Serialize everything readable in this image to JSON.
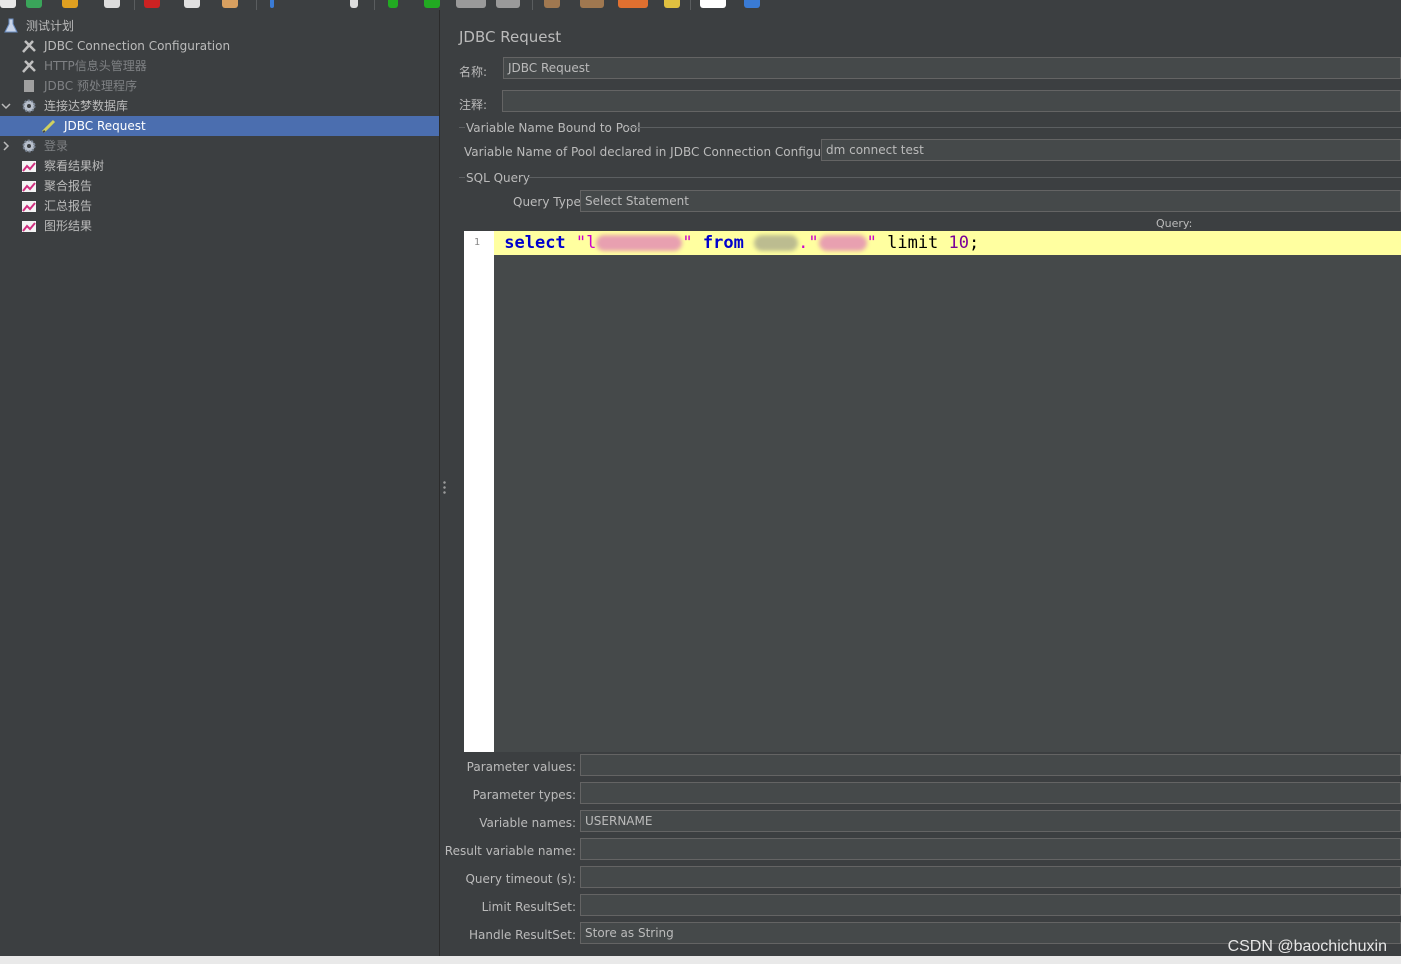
{
  "window": {
    "watermark": "CSDN @baochichuxin"
  },
  "tree": {
    "items": [
      {
        "label": "测试计划",
        "icon": "flask-icon",
        "level": 0,
        "selected": false,
        "disabled": false,
        "expander": ""
      },
      {
        "label": "JDBC Connection Configuration",
        "icon": "wrench-icon",
        "level": 1,
        "selected": false,
        "disabled": false,
        "expander": ""
      },
      {
        "label": "HTTP信息头管理器",
        "icon": "wrench-icon",
        "level": 1,
        "selected": false,
        "disabled": true,
        "expander": ""
      },
      {
        "label": "JDBC 预处理程序",
        "icon": "script-icon",
        "level": 1,
        "selected": false,
        "disabled": true,
        "expander": ""
      },
      {
        "label": "连接达梦数据库",
        "icon": "gear-icon",
        "level": 1,
        "selected": false,
        "disabled": false,
        "expander": "v"
      },
      {
        "label": "JDBC Request",
        "icon": "pen-icon",
        "level": 2,
        "selected": true,
        "disabled": false,
        "expander": ""
      },
      {
        "label": "登录",
        "icon": "gear-icon",
        "level": 1,
        "selected": false,
        "disabled": true,
        "expander": ">"
      },
      {
        "label": "察看结果树",
        "icon": "chart-icon",
        "level": 1,
        "selected": false,
        "disabled": false,
        "expander": ""
      },
      {
        "label": "聚合报告",
        "icon": "chart-icon",
        "level": 1,
        "selected": false,
        "disabled": false,
        "expander": ""
      },
      {
        "label": "汇总报告",
        "icon": "chart-icon",
        "level": 1,
        "selected": false,
        "disabled": false,
        "expander": ""
      },
      {
        "label": "图形结果",
        "icon": "chart-icon",
        "level": 1,
        "selected": false,
        "disabled": false,
        "expander": ""
      }
    ]
  },
  "form": {
    "title": "JDBC Request",
    "name_label": "名称:",
    "name_value": "JDBC Request",
    "comment_label": "注释:",
    "comment_value": "",
    "pool_group": "Variable Name Bound to Pool",
    "pool_label": "Variable Name of Pool declared in JDBC Connection Configuration:",
    "pool_value": "dm connect test",
    "sql_group": "SQL Query",
    "query_type_label": "Query Type:",
    "query_type_value": "Select Statement",
    "query_label": "Query:",
    "line_number": "1",
    "code": {
      "kw_select": "select",
      "quote_open": "\"",
      "partial_char": "l",
      "quote_close": "\"",
      "kw_from": "from",
      "dot_quote": ".\"",
      "quote_end": "\"",
      "kw_limit": "limit",
      "limit_value": "10",
      "semicolon": ";"
    },
    "params": [
      {
        "label": "Parameter values:",
        "value": ""
      },
      {
        "label": "Parameter types:",
        "value": ""
      },
      {
        "label": "Variable names:",
        "value": "USERNAME"
      },
      {
        "label": "Result variable name:",
        "value": ""
      },
      {
        "label": "Query timeout (s):",
        "value": ""
      },
      {
        "label": "Limit ResultSet:",
        "value": ""
      },
      {
        "label": "Handle ResultSet:",
        "value": "Store as String"
      }
    ]
  }
}
